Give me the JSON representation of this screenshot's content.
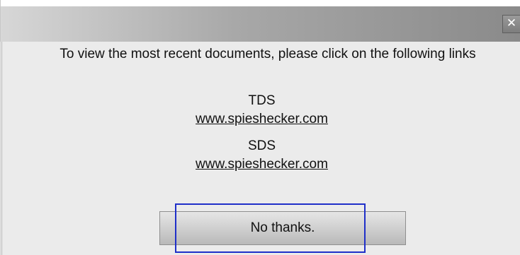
{
  "dialog": {
    "close_glyph": "✕",
    "message": "To view the most recent documents, please click on the following links",
    "documents": [
      {
        "label": "TDS",
        "link": "www.spieshecker.com"
      },
      {
        "label": "SDS",
        "link": "www.spieshecker.com"
      }
    ],
    "dismiss_label": "No thanks."
  },
  "colors": {
    "focus_ring": "#1f2fc9",
    "body_background": "#ebebeb"
  }
}
